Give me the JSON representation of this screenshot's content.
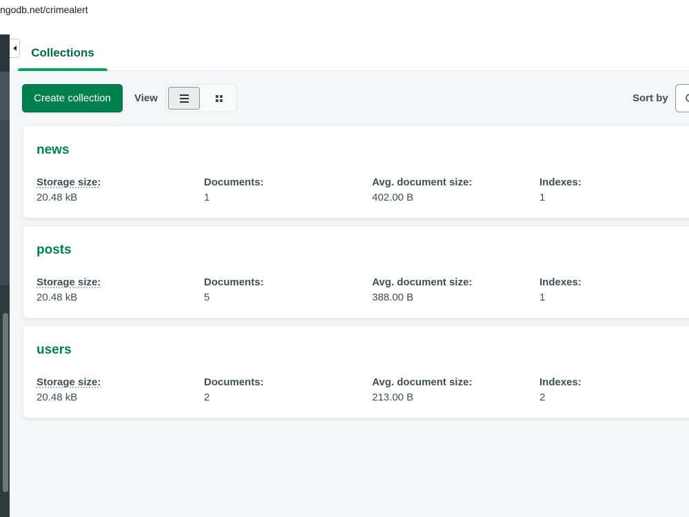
{
  "browser": {
    "url": "ngodb.net/crimealert"
  },
  "tabs": [
    {
      "label": "Collections"
    }
  ],
  "toolbar": {
    "create_label": "Create collection",
    "view_label": "View",
    "sort_label": "Sort by"
  },
  "collections": [
    {
      "name": "news",
      "storage_label": "Storage size:",
      "storage": "20.48 kB",
      "docs_label": "Documents:",
      "docs": "1",
      "avg_label": "Avg. document size:",
      "avg": "402.00 B",
      "idx_label": "Indexes:",
      "idx": "1"
    },
    {
      "name": "posts",
      "storage_label": "Storage size:",
      "storage": "20.48 kB",
      "docs_label": "Documents:",
      "docs": "5",
      "avg_label": "Avg. document size:",
      "avg": "388.00 B",
      "idx_label": "Indexes:",
      "idx": "1"
    },
    {
      "name": "users",
      "storage_label": "Storage size:",
      "storage": "20.48 kB",
      "docs_label": "Documents:",
      "docs": "2",
      "avg_label": "Avg. document size:",
      "avg": "213.00 B",
      "idx_label": "Indexes:",
      "idx": "2"
    }
  ],
  "colors": {
    "accent": "#00804f",
    "tab_underline": "#00a35c",
    "background": "#f5f6f7",
    "sidebar": "#374348"
  },
  "icons": {
    "collapse": "caret-left-icon",
    "list_view": "list-icon",
    "grid_view": "grid-icon",
    "sort": "sort-icon"
  }
}
